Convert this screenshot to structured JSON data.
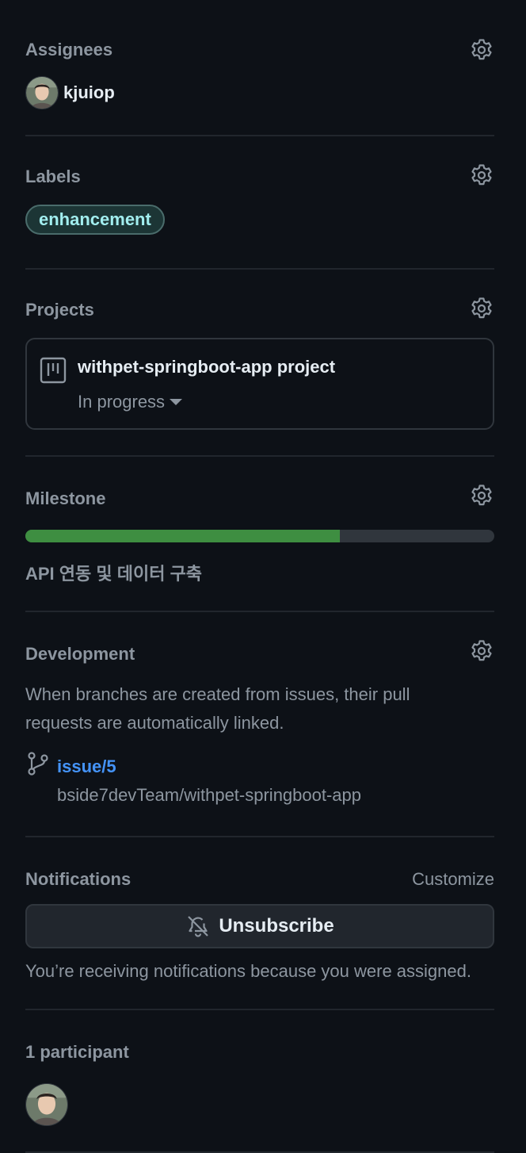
{
  "assignees": {
    "title": "Assignees",
    "items": [
      {
        "login": "kjuiop"
      }
    ]
  },
  "labels": {
    "title": "Labels",
    "items": [
      {
        "name": "enhancement",
        "color": "#a2eeef"
      }
    ]
  },
  "projects": {
    "title": "Projects",
    "items": [
      {
        "name": "withpet-springboot-app project",
        "status": "In progress"
      }
    ]
  },
  "milestone": {
    "title": "Milestone",
    "name": "API 연동 및 데이터 구축",
    "progress_percent": 67
  },
  "development": {
    "title": "Development",
    "description": "When branches are created from issues, their pull requests are automatically linked.",
    "branches": [
      {
        "name": "issue/5",
        "repo": "bside7devTeam/withpet-springboot-app"
      }
    ]
  },
  "notifications": {
    "title": "Notifications",
    "customize_label": "Customize",
    "unsubscribe_label": "Unsubscribe",
    "reason": "You’re receiving notifications because you were assigned."
  },
  "participants": {
    "title": "1 participant"
  },
  "colors": {
    "background": "#0d1117",
    "border": "#30363d",
    "muted_text": "#8d96a0",
    "link": "#4493f8",
    "progress": "#3e8e41"
  }
}
